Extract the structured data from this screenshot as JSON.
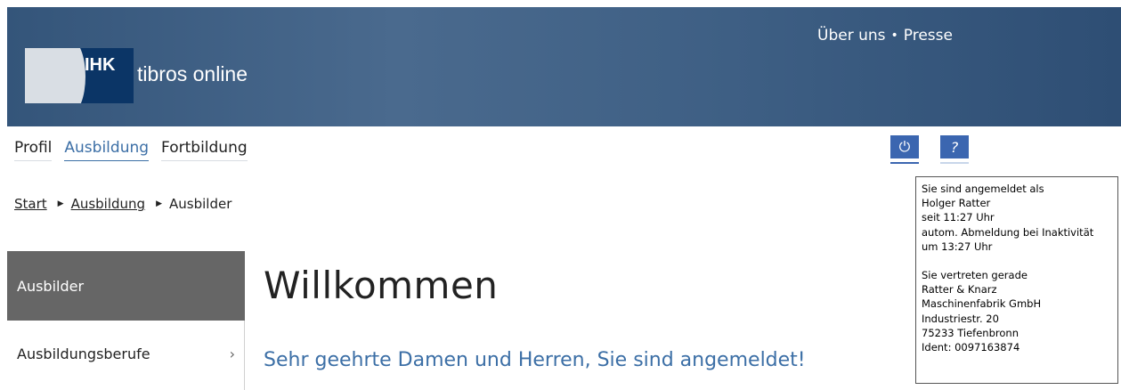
{
  "header": {
    "logo_text": "IHK",
    "app_title": "tibros online",
    "links": [
      "Über uns",
      "Presse"
    ],
    "link_separator": "•"
  },
  "main_nav": [
    {
      "label": "Profil",
      "active": false
    },
    {
      "label": "Ausbildung",
      "active": true
    },
    {
      "label": "Fortbildung",
      "active": false
    }
  ],
  "icons": {
    "logout": {
      "name": "power-icon",
      "glyph": "⏻"
    },
    "help": {
      "name": "help-icon",
      "glyph": "?"
    }
  },
  "breadcrumb": [
    "Start",
    "Ausbildung",
    "Ausbilder"
  ],
  "sidebar": {
    "items": [
      {
        "label": "Ausbilder",
        "active": true
      },
      {
        "label": "Ausbildungsberufe",
        "active": false,
        "chevron": "›"
      }
    ]
  },
  "main": {
    "heading": "Willkommen",
    "subtitle": "Sehr geehrte Damen und Herren, Sie sind angemeldet!"
  },
  "session_tooltip": {
    "line1": "Sie sind angemeldet als",
    "user": "Holger Ratter",
    "since": "seit 11:27 Uhr",
    "autologout": "autom. Abmeldung bei Inaktivität",
    "autologout_time": "um 13:27 Uhr",
    "represent": "Sie vertreten gerade",
    "company_line1": "Ratter & Knarz",
    "company_line2": "Maschinenfabrik GmbH",
    "street": "Industriestr. 20",
    "city": "75233 Tiefenbronn",
    "ident": "Ident: 0097163874"
  },
  "colors": {
    "header_bg": "#3e5f84",
    "accent_blue": "#3c6fa6",
    "icon_button": "#3b66b0",
    "sidebar_active": "#666666"
  }
}
